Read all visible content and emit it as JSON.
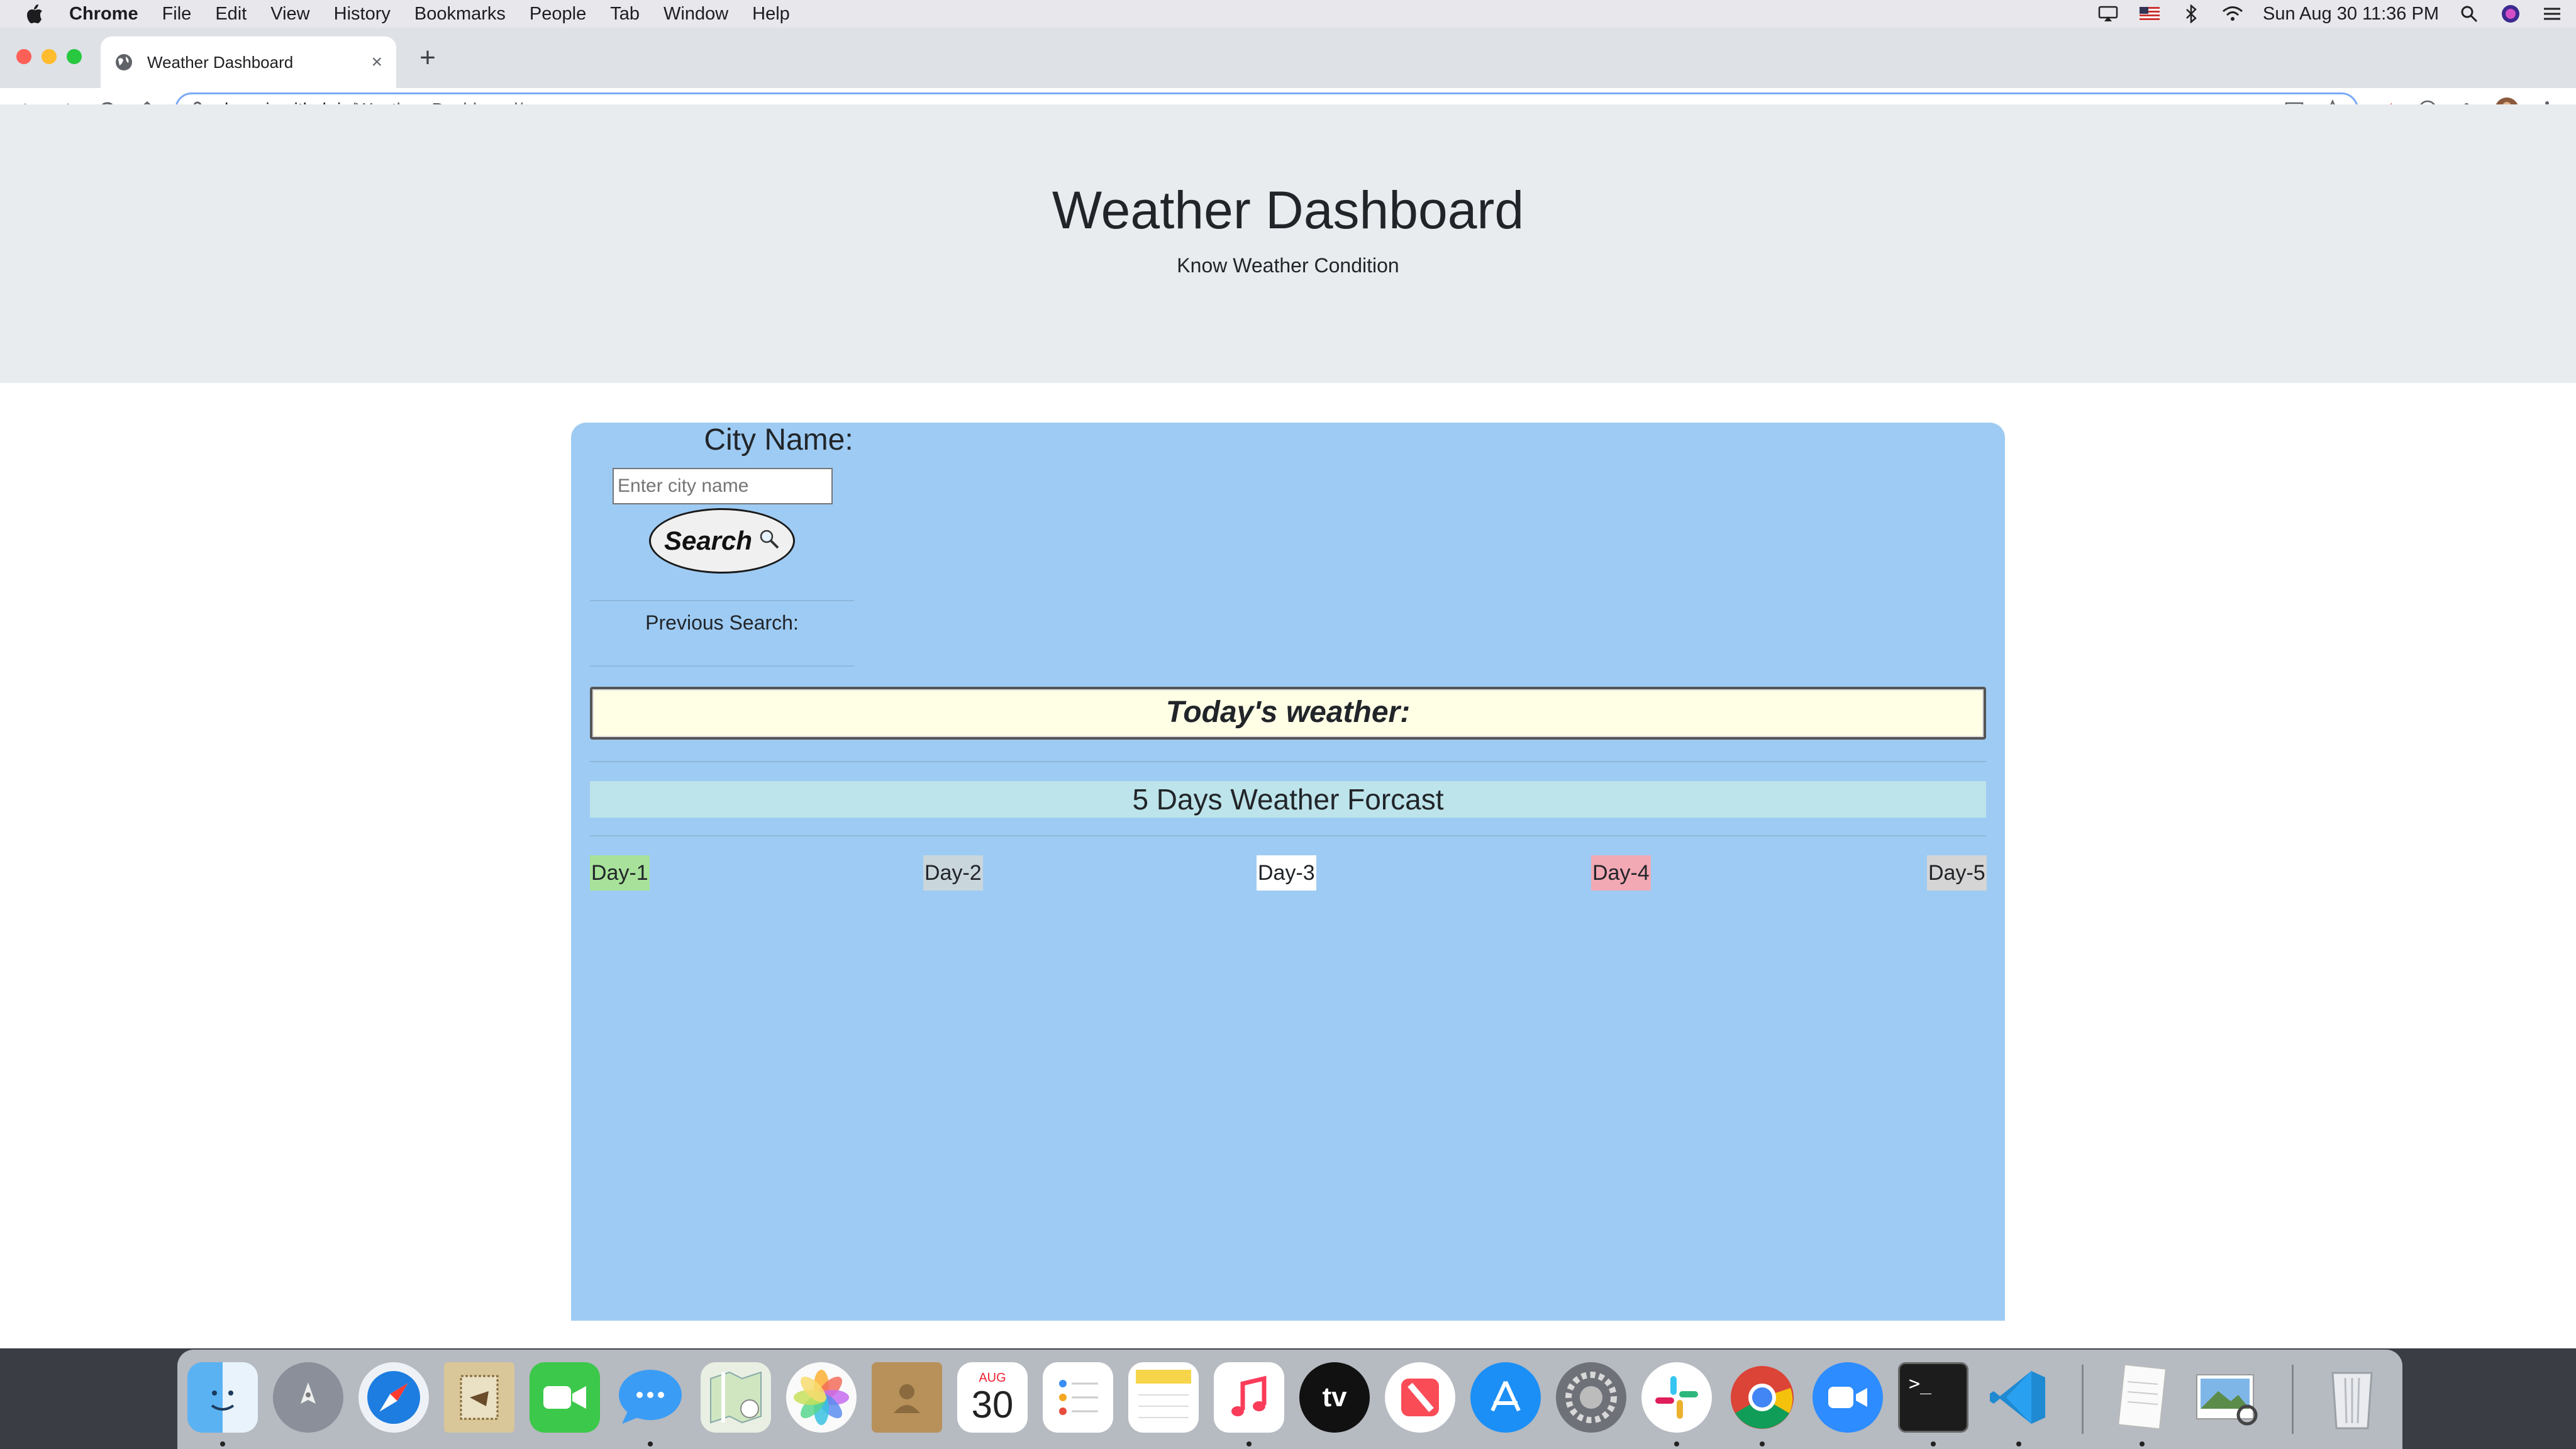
{
  "menubar": {
    "app_name": "Chrome",
    "items": [
      "File",
      "Edit",
      "View",
      "History",
      "Bookmarks",
      "People",
      "Tab",
      "Window",
      "Help"
    ],
    "datetime": "Sun Aug 30  11:36 PM"
  },
  "browser": {
    "tab_title": "Weather Dashboard",
    "tab_close": "×",
    "new_tab": "+",
    "url_host": "shreraje.github.io",
    "url_path": "/Weather_Dashboard/"
  },
  "page": {
    "title": "Weather Dashboard",
    "subtitle": "Know Weather Condition",
    "city_label": "City Name:",
    "city_placeholder": "Enter city name",
    "search_label": "Search",
    "previous_label": "Previous Search:",
    "today_label": "Today's weather:",
    "forecast_title": "5 Days Weather Forcast",
    "days": [
      {
        "label": "Day-1",
        "color": "#a8e29a"
      },
      {
        "label": "Day-2",
        "color": "#c9d6dc"
      },
      {
        "label": "Day-3",
        "color": "#ffffff"
      },
      {
        "label": "Day-4",
        "color": "#f2a9b4"
      },
      {
        "label": "Day-5",
        "color": "#d5d5d5"
      }
    ]
  },
  "dock": {
    "calendar_month": "AUG",
    "calendar_day": "30",
    "apps": [
      "finder-icon",
      "launchpad-icon",
      "safari-icon",
      "mail-icon",
      "facetime-icon",
      "messages-icon",
      "maps-icon",
      "photos-icon",
      "contacts-icon",
      "calendar-icon",
      "reminders-icon",
      "notes-icon",
      "music-icon",
      "tv-icon",
      "news-icon",
      "app-store-icon",
      "system-preferences-icon",
      "slack-icon",
      "chrome-icon",
      "zoom-icon",
      "terminal-icon",
      "vscode-icon",
      "textedit-icon",
      "preview-icon",
      "trash-icon"
    ]
  }
}
